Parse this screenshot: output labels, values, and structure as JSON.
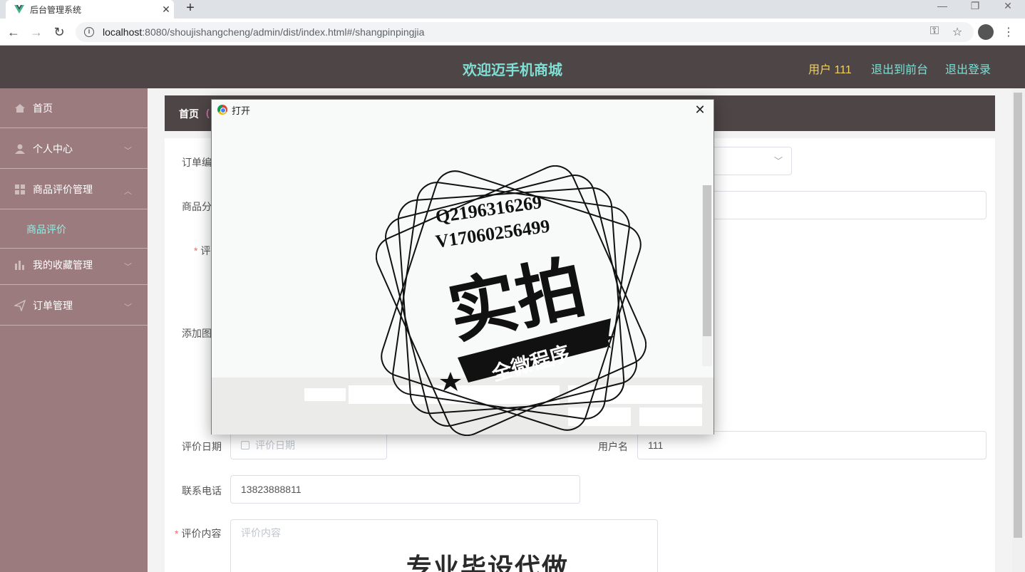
{
  "browser": {
    "tab_title": "后台管理系统",
    "tab_close": "✕",
    "new_tab": "+",
    "url_host": "localhost",
    "url_rest": ":8080/shoujishangcheng/admin/dist/index.html#/shangpinpingjia",
    "minimize": "—",
    "restore": "❐",
    "close": "✕"
  },
  "header": {
    "title": "欢迎迈手机商城",
    "user": "用户 111",
    "to_front": "退出到前台",
    "logout": "退出登录"
  },
  "sidebar": {
    "items": [
      {
        "label": "首页"
      },
      {
        "label": "个人中心"
      },
      {
        "label": "商品评价管理"
      },
      {
        "label": "我的收藏管理"
      },
      {
        "label": "订单管理"
      }
    ],
    "sub_item": "商品评价"
  },
  "breadcrumb": {
    "home": "首页",
    "paren": "("
  },
  "form": {
    "order_no_label": "订单编",
    "category_label": "商品分",
    "rating_label": "评",
    "add_image_label": "添加图",
    "date_label": "评价日期",
    "date_placeholder": "评价日期",
    "username_label": "用户名",
    "username_value": "111",
    "phone_label": "联系电话",
    "phone_value": "13823888811",
    "content_label": "评价内容",
    "content_placeholder": "评价内容",
    "required_mark": "*",
    "bottom_watermark": "专业毕设代做"
  },
  "dialog": {
    "title": "打开",
    "close": "✕",
    "stamp": {
      "line1": "Q2196316269",
      "line2": "V17060256499",
      "big": "实拍",
      "ribbon": "全微程序"
    }
  },
  "colors": {
    "header_bg": "#4e4646",
    "sidebar_bg": "#9b7b7e",
    "accent_teal": "#7fdfd4",
    "accent_yellow": "#f0d060"
  }
}
